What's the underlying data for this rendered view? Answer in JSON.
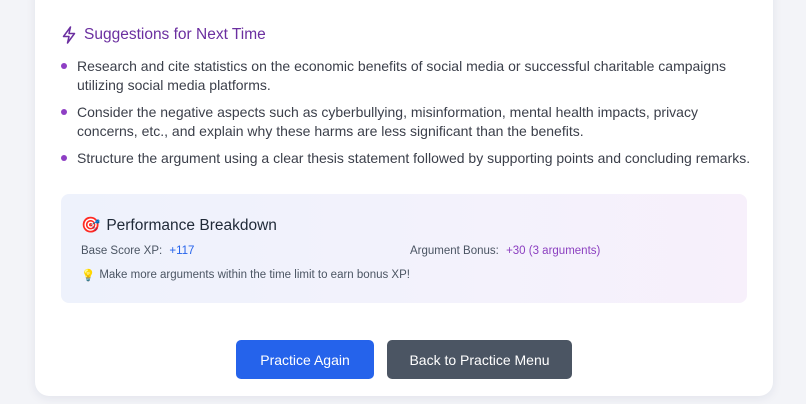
{
  "suggestions": {
    "title": "Suggestions for Next Time",
    "icon": "lightning-bolt-icon",
    "items": [
      "Research and cite statistics on the economic benefits of social media or successful charitable campaigns utilizing social media platforms.",
      "Consider the negative aspects such as cyberbullying, misinformation, mental health impacts, privacy concerns, etc., and explain why these harms are less significant than the benefits.",
      "Structure the argument using a clear thesis statement followed by supporting points and concluding remarks."
    ]
  },
  "performance": {
    "icon": "🎯",
    "title": "Performance Breakdown",
    "base_label": "Base Score XP:",
    "base_value": "+117",
    "bonus_label": "Argument Bonus:",
    "bonus_value": "+30 (3 arguments)",
    "tip_icon": "💡",
    "tip": "Make more arguments within the time limit to earn bonus XP!"
  },
  "buttons": {
    "practice_again": "Practice Again",
    "back_to_menu": "Back to Practice Menu"
  },
  "colors": {
    "accent_purple": "#6b2fa0",
    "primary_blue": "#2563eb",
    "secondary_gray": "#4b5563"
  }
}
